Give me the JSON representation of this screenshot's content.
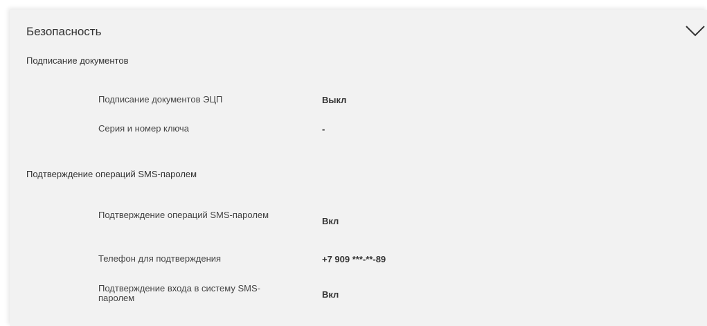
{
  "panel": {
    "title": "Безопасность",
    "toggle_icon": "chevron-down-icon"
  },
  "sections": [
    {
      "title": "Подписание документов",
      "rows": [
        {
          "label": "Подписание документов ЭЦП",
          "value": "Выкл"
        },
        {
          "label": "Серия и номер ключа",
          "value": "-"
        }
      ]
    },
    {
      "title": "Подтверждение операций SMS-паролем",
      "rows": [
        {
          "label": "Подтверждение операций SMS-паролем",
          "value": "Вкл"
        },
        {
          "label": "Телефон для подтверждения",
          "value": "+7 909 ***-**-89"
        },
        {
          "label": "Подтверждение входа в систему SMS-паролем",
          "value": "Вкл"
        }
      ]
    }
  ]
}
